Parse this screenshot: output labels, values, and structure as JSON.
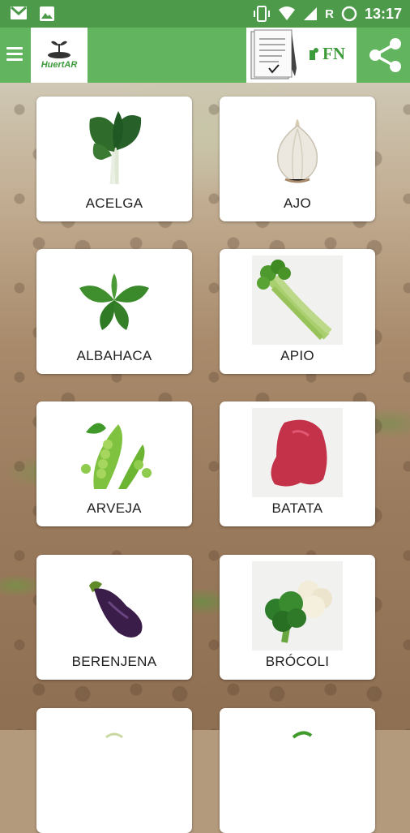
{
  "status_bar": {
    "time": "13:17",
    "network_letter": "R"
  },
  "app_bar": {
    "logo_text": "HuertAR",
    "fn_label": "FN"
  },
  "vegetables": [
    {
      "label": "ACELGA",
      "icon": "chard-icon"
    },
    {
      "label": "AJO",
      "icon": "garlic-icon"
    },
    {
      "label": "ALBAHACA",
      "icon": "basil-icon"
    },
    {
      "label": "APIO",
      "icon": "celery-icon"
    },
    {
      "label": "ARVEJA",
      "icon": "pea-icon"
    },
    {
      "label": "BATATA",
      "icon": "sweet-potato-icon"
    },
    {
      "label": "BERENJENA",
      "icon": "eggplant-icon"
    },
    {
      "label": "BRÓCOLI",
      "icon": "broccoli-icon"
    },
    {
      "label": "",
      "icon": "vegetable-icon"
    },
    {
      "label": "",
      "icon": "vegetable-icon"
    }
  ]
}
